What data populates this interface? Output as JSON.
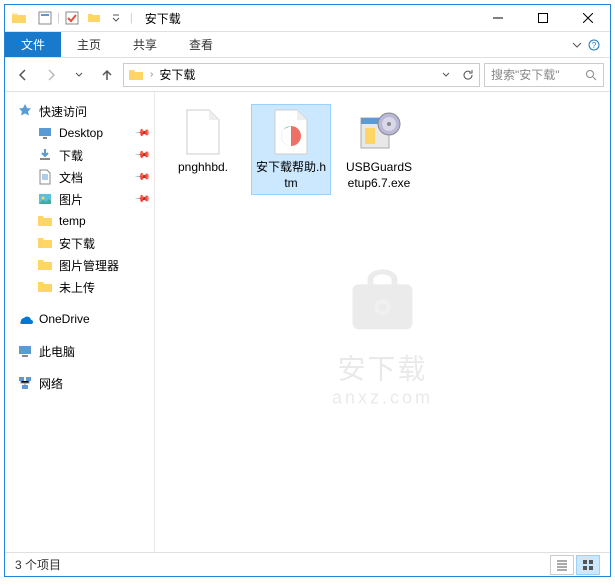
{
  "window": {
    "title": "安下载",
    "separator": "|"
  },
  "ribbon": {
    "file": "文件",
    "tabs": [
      "主页",
      "共享",
      "查看"
    ]
  },
  "nav": {
    "address_prefix": "›",
    "address": "安下载",
    "search_placeholder": "搜索\"安下载\""
  },
  "sidebar": {
    "quick_access": "快速访问",
    "items": [
      {
        "label": "Desktop",
        "pinned": true
      },
      {
        "label": "下载",
        "pinned": true
      },
      {
        "label": "文档",
        "pinned": true
      },
      {
        "label": "图片",
        "pinned": true
      },
      {
        "label": "temp",
        "pinned": false
      },
      {
        "label": "安下载",
        "pinned": false
      },
      {
        "label": "图片管理器",
        "pinned": false
      },
      {
        "label": "未上传",
        "pinned": false
      }
    ],
    "onedrive": "OneDrive",
    "thispc": "此电脑",
    "network": "网络"
  },
  "files": [
    {
      "name": "pnghhbd.",
      "type": "blank",
      "selected": false
    },
    {
      "name": "安下载帮助.htm",
      "type": "htm",
      "selected": true
    },
    {
      "name": "USBGuardSetup6.7.exe",
      "type": "exe",
      "selected": false
    }
  ],
  "watermark": {
    "line1": "安下载",
    "line2": "anxz.com"
  },
  "status": {
    "text": "3 个项目"
  }
}
